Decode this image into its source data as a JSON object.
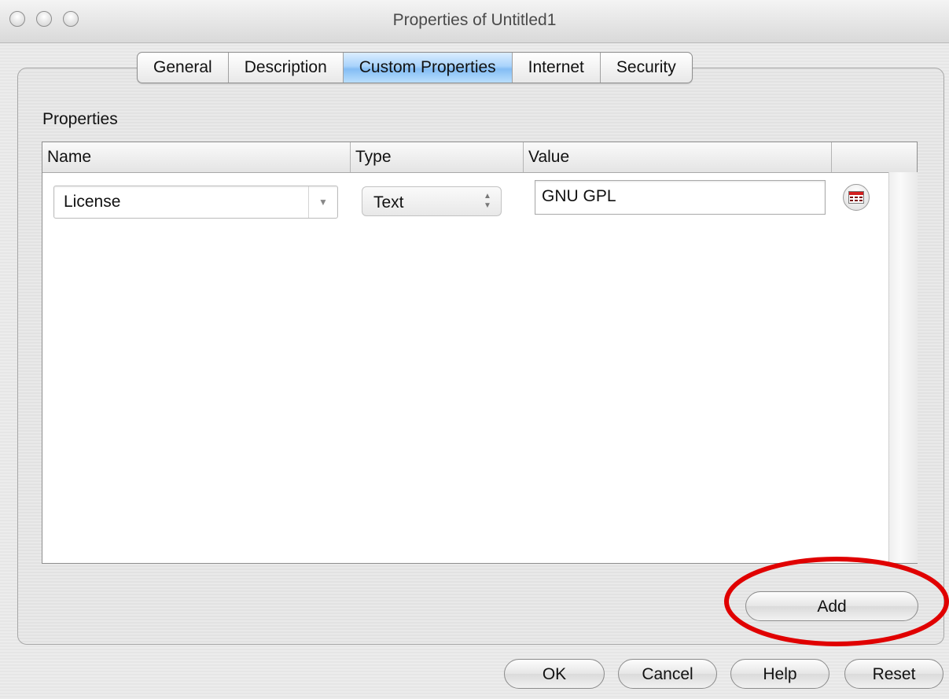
{
  "window": {
    "title": "Properties of Untitled1"
  },
  "tabs": [
    {
      "label": "General",
      "active": false
    },
    {
      "label": "Description",
      "active": false
    },
    {
      "label": "Custom Properties",
      "active": true
    },
    {
      "label": "Internet",
      "active": false
    },
    {
      "label": "Security",
      "active": false
    }
  ],
  "properties": {
    "section_label": "Properties",
    "columns": [
      "Name",
      "Type",
      "Value"
    ],
    "rows": [
      {
        "name": "License",
        "type": "Text",
        "value": "GNU GPL"
      }
    ],
    "add_label": "Add"
  },
  "footer": {
    "ok": "OK",
    "cancel": "Cancel",
    "help": "Help",
    "reset": "Reset"
  },
  "colors": {
    "active_tab": "#84bdf4",
    "highlight": "#e00000"
  },
  "icons": [
    "calendar-icon",
    "chevron-down-icon",
    "stepper-arrows-icon"
  ]
}
